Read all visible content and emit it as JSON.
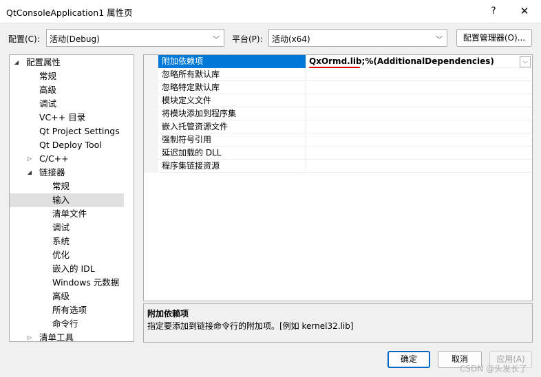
{
  "window": {
    "title": "QtConsoleApplication1 属性页",
    "help": "?",
    "close": "✕"
  },
  "toolbar": {
    "config_label": "配置(C):",
    "config_value": "活动(Debug)",
    "platform_label": "平台(P):",
    "platform_value": "活动(x64)",
    "manager_button": "配置管理器(O)..."
  },
  "tree": [
    {
      "label": "配置属性",
      "level": 0,
      "expander": "◢"
    },
    {
      "label": "常规",
      "level": 1
    },
    {
      "label": "高级",
      "level": 1
    },
    {
      "label": "调试",
      "level": 1
    },
    {
      "label": "VC++ 目录",
      "level": 1
    },
    {
      "label": "Qt Project Settings",
      "level": 1
    },
    {
      "label": "Qt Deploy Tool",
      "level": 1
    },
    {
      "label": "C/C++",
      "level": 1,
      "expander": "▷"
    },
    {
      "label": "链接器",
      "level": 1,
      "expander": "◢"
    },
    {
      "label": "常规",
      "level": 2
    },
    {
      "label": "输入",
      "level": 2,
      "selected": true
    },
    {
      "label": "清单文件",
      "level": 2
    },
    {
      "label": "调试",
      "level": 2
    },
    {
      "label": "系统",
      "level": 2
    },
    {
      "label": "优化",
      "level": 2
    },
    {
      "label": "嵌入的 IDL",
      "level": 2
    },
    {
      "label": "Windows 元数据",
      "level": 2
    },
    {
      "label": "高级",
      "level": 2
    },
    {
      "label": "所有选项",
      "level": 2
    },
    {
      "label": "命令行",
      "level": 2
    },
    {
      "label": "清单工具",
      "level": 1,
      "expander": "▷"
    }
  ],
  "properties": [
    {
      "name": "附加依赖项",
      "value_highlight": "QxOrmd.lib",
      "value_rest": ";%(AdditionalDependencies)",
      "selected": true,
      "dropdown": "⌵"
    },
    {
      "name": "忽略所有默认库",
      "value": ""
    },
    {
      "name": "忽略特定默认库",
      "value": ""
    },
    {
      "name": "模块定义文件",
      "value": ""
    },
    {
      "name": "将模块添加到程序集",
      "value": ""
    },
    {
      "name": "嵌入托管资源文件",
      "value": ""
    },
    {
      "name": "强制符号引用",
      "value": ""
    },
    {
      "name": "延迟加载的 DLL",
      "value": ""
    },
    {
      "name": "程序集链接资源",
      "value": ""
    }
  ],
  "description": {
    "title": "附加依赖项",
    "text": "指定要添加到链接命令行的附加项。[例如 kernel32.lib]"
  },
  "buttons": {
    "ok": "确定",
    "cancel": "取消",
    "apply": "应用(A)"
  },
  "watermark": "CSDN @头发长了",
  "colors": {
    "selection": "#0078d7",
    "underline": "#dd0000",
    "default_border": "#0067c0"
  },
  "icons": {
    "help": "question-mark-icon",
    "close": "close-icon",
    "combo": "chevron-down-icon"
  }
}
